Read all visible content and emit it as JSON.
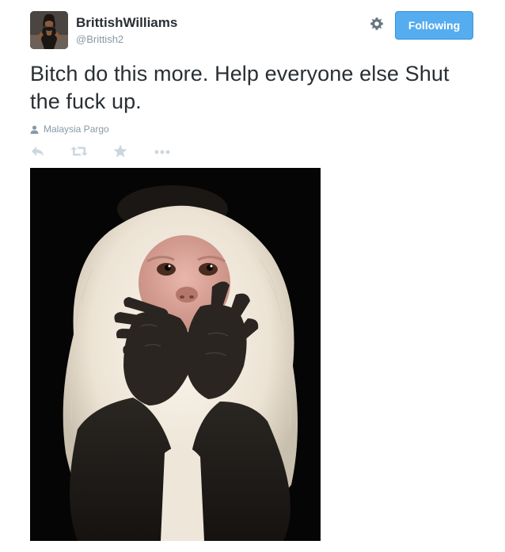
{
  "tweet": {
    "author": {
      "display_name": "BrittishWilliams",
      "handle": "@Brittish2",
      "avatar_icon": "profile-photo"
    },
    "follow_button": {
      "label": "Following",
      "color": "#55acee"
    },
    "settings_icon": "gear-icon",
    "text": "Bitch do this more. Help everyone else Shut the fuck up.",
    "context": {
      "icon": "person-icon",
      "label": "Malaysia Pargo"
    },
    "actions": [
      {
        "name": "reply",
        "icon": "reply-icon"
      },
      {
        "name": "retweet",
        "icon": "retweet-icon"
      },
      {
        "name": "favorite",
        "icon": "star-icon"
      },
      {
        "name": "more",
        "icon": "more-icon"
      }
    ],
    "media": {
      "subject": "monkey covering mouth"
    }
  },
  "colors": {
    "text": "#292f33",
    "muted": "#8899a6",
    "action_icons": "#ccd6dd",
    "accent": "#55acee"
  }
}
